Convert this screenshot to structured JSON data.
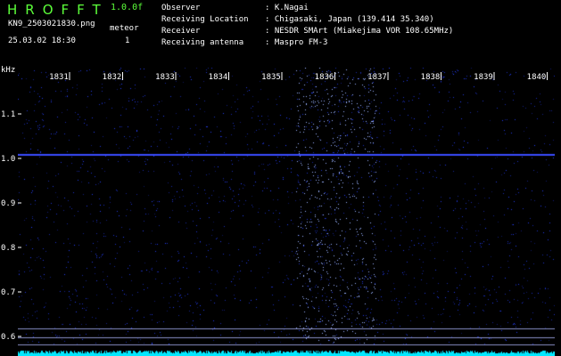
{
  "header": {
    "logo": "HROFFT",
    "version": "1.0.0f",
    "filename": "KN9_2503021830.png",
    "meteor_label": "meteor",
    "datetime": "25.03.02 18:30",
    "meteor_count": "1"
  },
  "info": [
    {
      "label": "Observer",
      "value": ": K.Nagai"
    },
    {
      "label": "Receiving Location",
      "value": ": Chigasaki, Japan (139.414 35.340)"
    },
    {
      "label": "Receiver",
      "value": ": NESDR SMArt (Miakejima VOR 108.65MHz)"
    },
    {
      "label": "Receiving antenna",
      "value": ": Maspro FM-3"
    }
  ],
  "axis": {
    "unit": "kHz",
    "freq_labels": [
      "1831",
      "1832",
      "1833",
      "1834",
      "1835",
      "1836",
      "1837",
      "1838",
      "1839",
      "1840"
    ],
    "y_labels": [
      "1.1",
      "1.0",
      "0.9",
      "0.8",
      "0.7",
      "0.6"
    ]
  },
  "colors": {
    "background": "#000000",
    "logo": "#5cff3a",
    "noise": "#1a2cff",
    "spectrum": "#00e8ff",
    "line": "#3a4cff"
  }
}
